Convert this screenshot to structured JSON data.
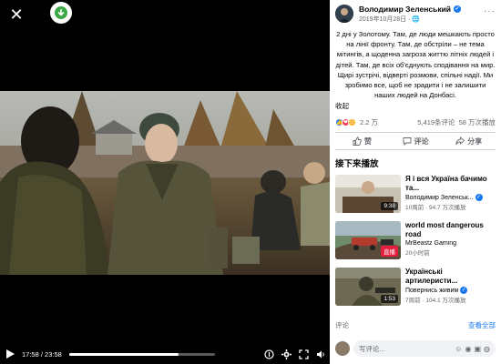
{
  "video": {
    "time_current": "17:58",
    "time_total": "23:58",
    "progress": 0.75
  },
  "post": {
    "author": "Володимир Зеленський",
    "date": "2019年10月28日 ·",
    "text": "2 дні у Золотому. Там, де люди мешкають просто на лінії фронту. Там, де обстріли – не тема мітингів, а щоденна загроза життю літніх людей і дітей. Там, де всіх об'єднують сподівання на мир. Щирі зустрічі, відверті розмови, спільні надії. Ми зробимо все, щоб не зрадити і не залишити наших людей на Донбасі.",
    "collapse": "收起",
    "likes": "2.2 万",
    "comments": "5,419条评论",
    "views": "58 万次播放"
  },
  "actions": {
    "like": "赞",
    "comment": "评论",
    "share": "分享"
  },
  "up_next": {
    "heading": "接下来播放",
    "items": [
      {
        "title": "Я і вся Україна бачимо та...",
        "channel": "Володимир Зеленськ...",
        "meta": "10周前 · 94.7 万次播放",
        "badge": "9:38",
        "verified": true
      },
      {
        "title": "world most dangerous road",
        "channel": "MrBeastz Gaming",
        "meta": "20小时前",
        "badge": "直播",
        "verified": false
      },
      {
        "title": "Українські артилеристи...",
        "channel": "Повернись живим",
        "meta": "7周前 · 104.1 万次播放",
        "badge": "1:53",
        "verified": true
      }
    ]
  },
  "comments": {
    "label": "评论",
    "more": "查看全部",
    "placeholder": "写评论..."
  },
  "colors": {
    "accent": "#1877f2",
    "live": "#e41e3f"
  }
}
